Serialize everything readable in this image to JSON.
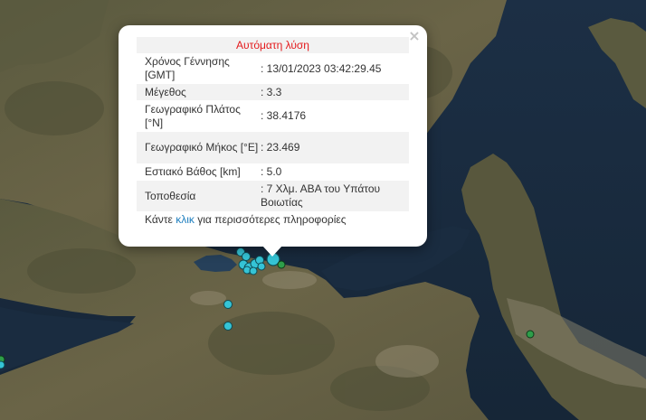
{
  "popup": {
    "heading": "Αυτόματη λύση",
    "close_symbol": "×",
    "rows": [
      {
        "key": "Χρόνος Γέννησης [GMT]",
        "value": ": 13/01/2023 03:42:29.45"
      },
      {
        "key": "Μέγεθος",
        "value": ": 3.3"
      },
      {
        "key": "Γεωγραφικό Πλάτος [°N]",
        "value": ": 38.4176"
      },
      {
        "key": "Γεωγραφικό Μήκος [°E]",
        "value": ": 23.469"
      },
      {
        "key": "Εστιακό Βάθος [km]",
        "value": ": 5.0"
      },
      {
        "key": "Τοποθεσία",
        "value": ": 7 Χλμ. ΑΒΑ του Υπάτου Βοιωτίας"
      }
    ],
    "more_prefix": "Κάντε ",
    "more_link": "κλικ",
    "more_suffix": " για περισσότερες πληροφορίες"
  },
  "colors": {
    "recent_event": "#35c4d6",
    "older_event": "#2e9e4a",
    "heading_text": "#e41a1c",
    "link": "#1f7fbf"
  }
}
